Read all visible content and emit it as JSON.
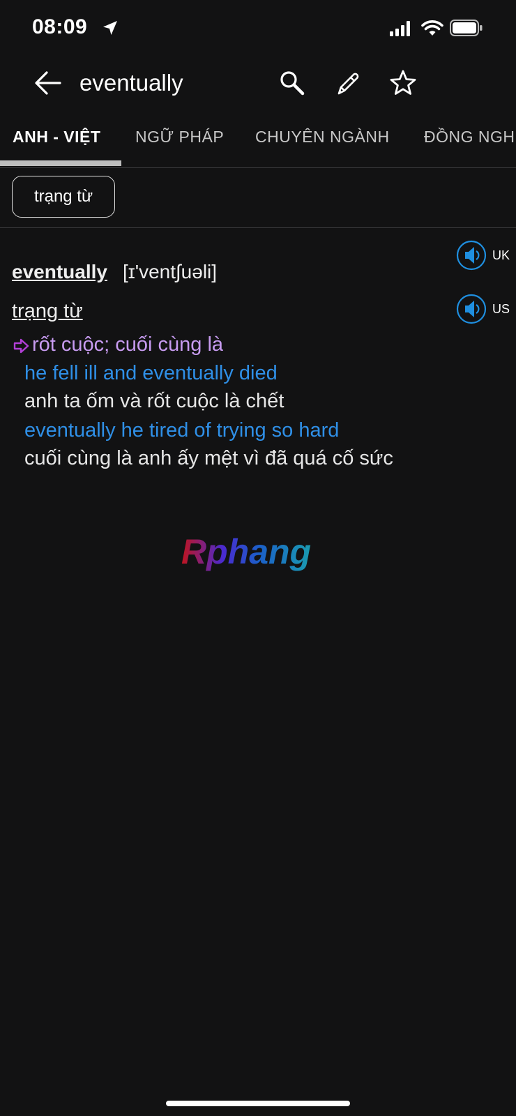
{
  "status_bar": {
    "time": "08:09",
    "icons": [
      "location-arrow-icon",
      "signal-icon",
      "wifi-icon",
      "battery-icon"
    ]
  },
  "header": {
    "title": "eventually",
    "icons": [
      "back-arrow-icon",
      "search-icon",
      "pencil-icon",
      "star-icon"
    ]
  },
  "tabs": [
    {
      "label": "ANH - VIỆT",
      "active": true
    },
    {
      "label": "NGỮ PHÁP",
      "active": false
    },
    {
      "label": "CHUYÊN NGÀNH",
      "active": false
    },
    {
      "label": "ĐỒNG NGH",
      "active": false
    }
  ],
  "chip": {
    "label": "trạng từ"
  },
  "entry": {
    "headword": "eventually",
    "phonetic": "[ɪ'vent∫uəli]",
    "part_of_speech": "trạng từ",
    "audio": [
      {
        "label": "UK"
      },
      {
        "label": "US"
      }
    ],
    "meaning": "rốt cuộc; cuối cùng là",
    "examples": [
      {
        "en": "he fell ill and eventually died",
        "vi": "anh ta ốm và rốt cuộc là chết"
      },
      {
        "en": "eventually he tired of trying so hard",
        "vi": "cuối cùng là anh ấy mệt vì đã quá cố sức"
      }
    ]
  },
  "watermark": {
    "text": "Rphang"
  },
  "colors": {
    "background": "#121213",
    "meaning": "#c79bf0",
    "example_en": "#2f8fe6",
    "audio_accent": "#1f8fe0",
    "arrow": "#b23fd6"
  }
}
